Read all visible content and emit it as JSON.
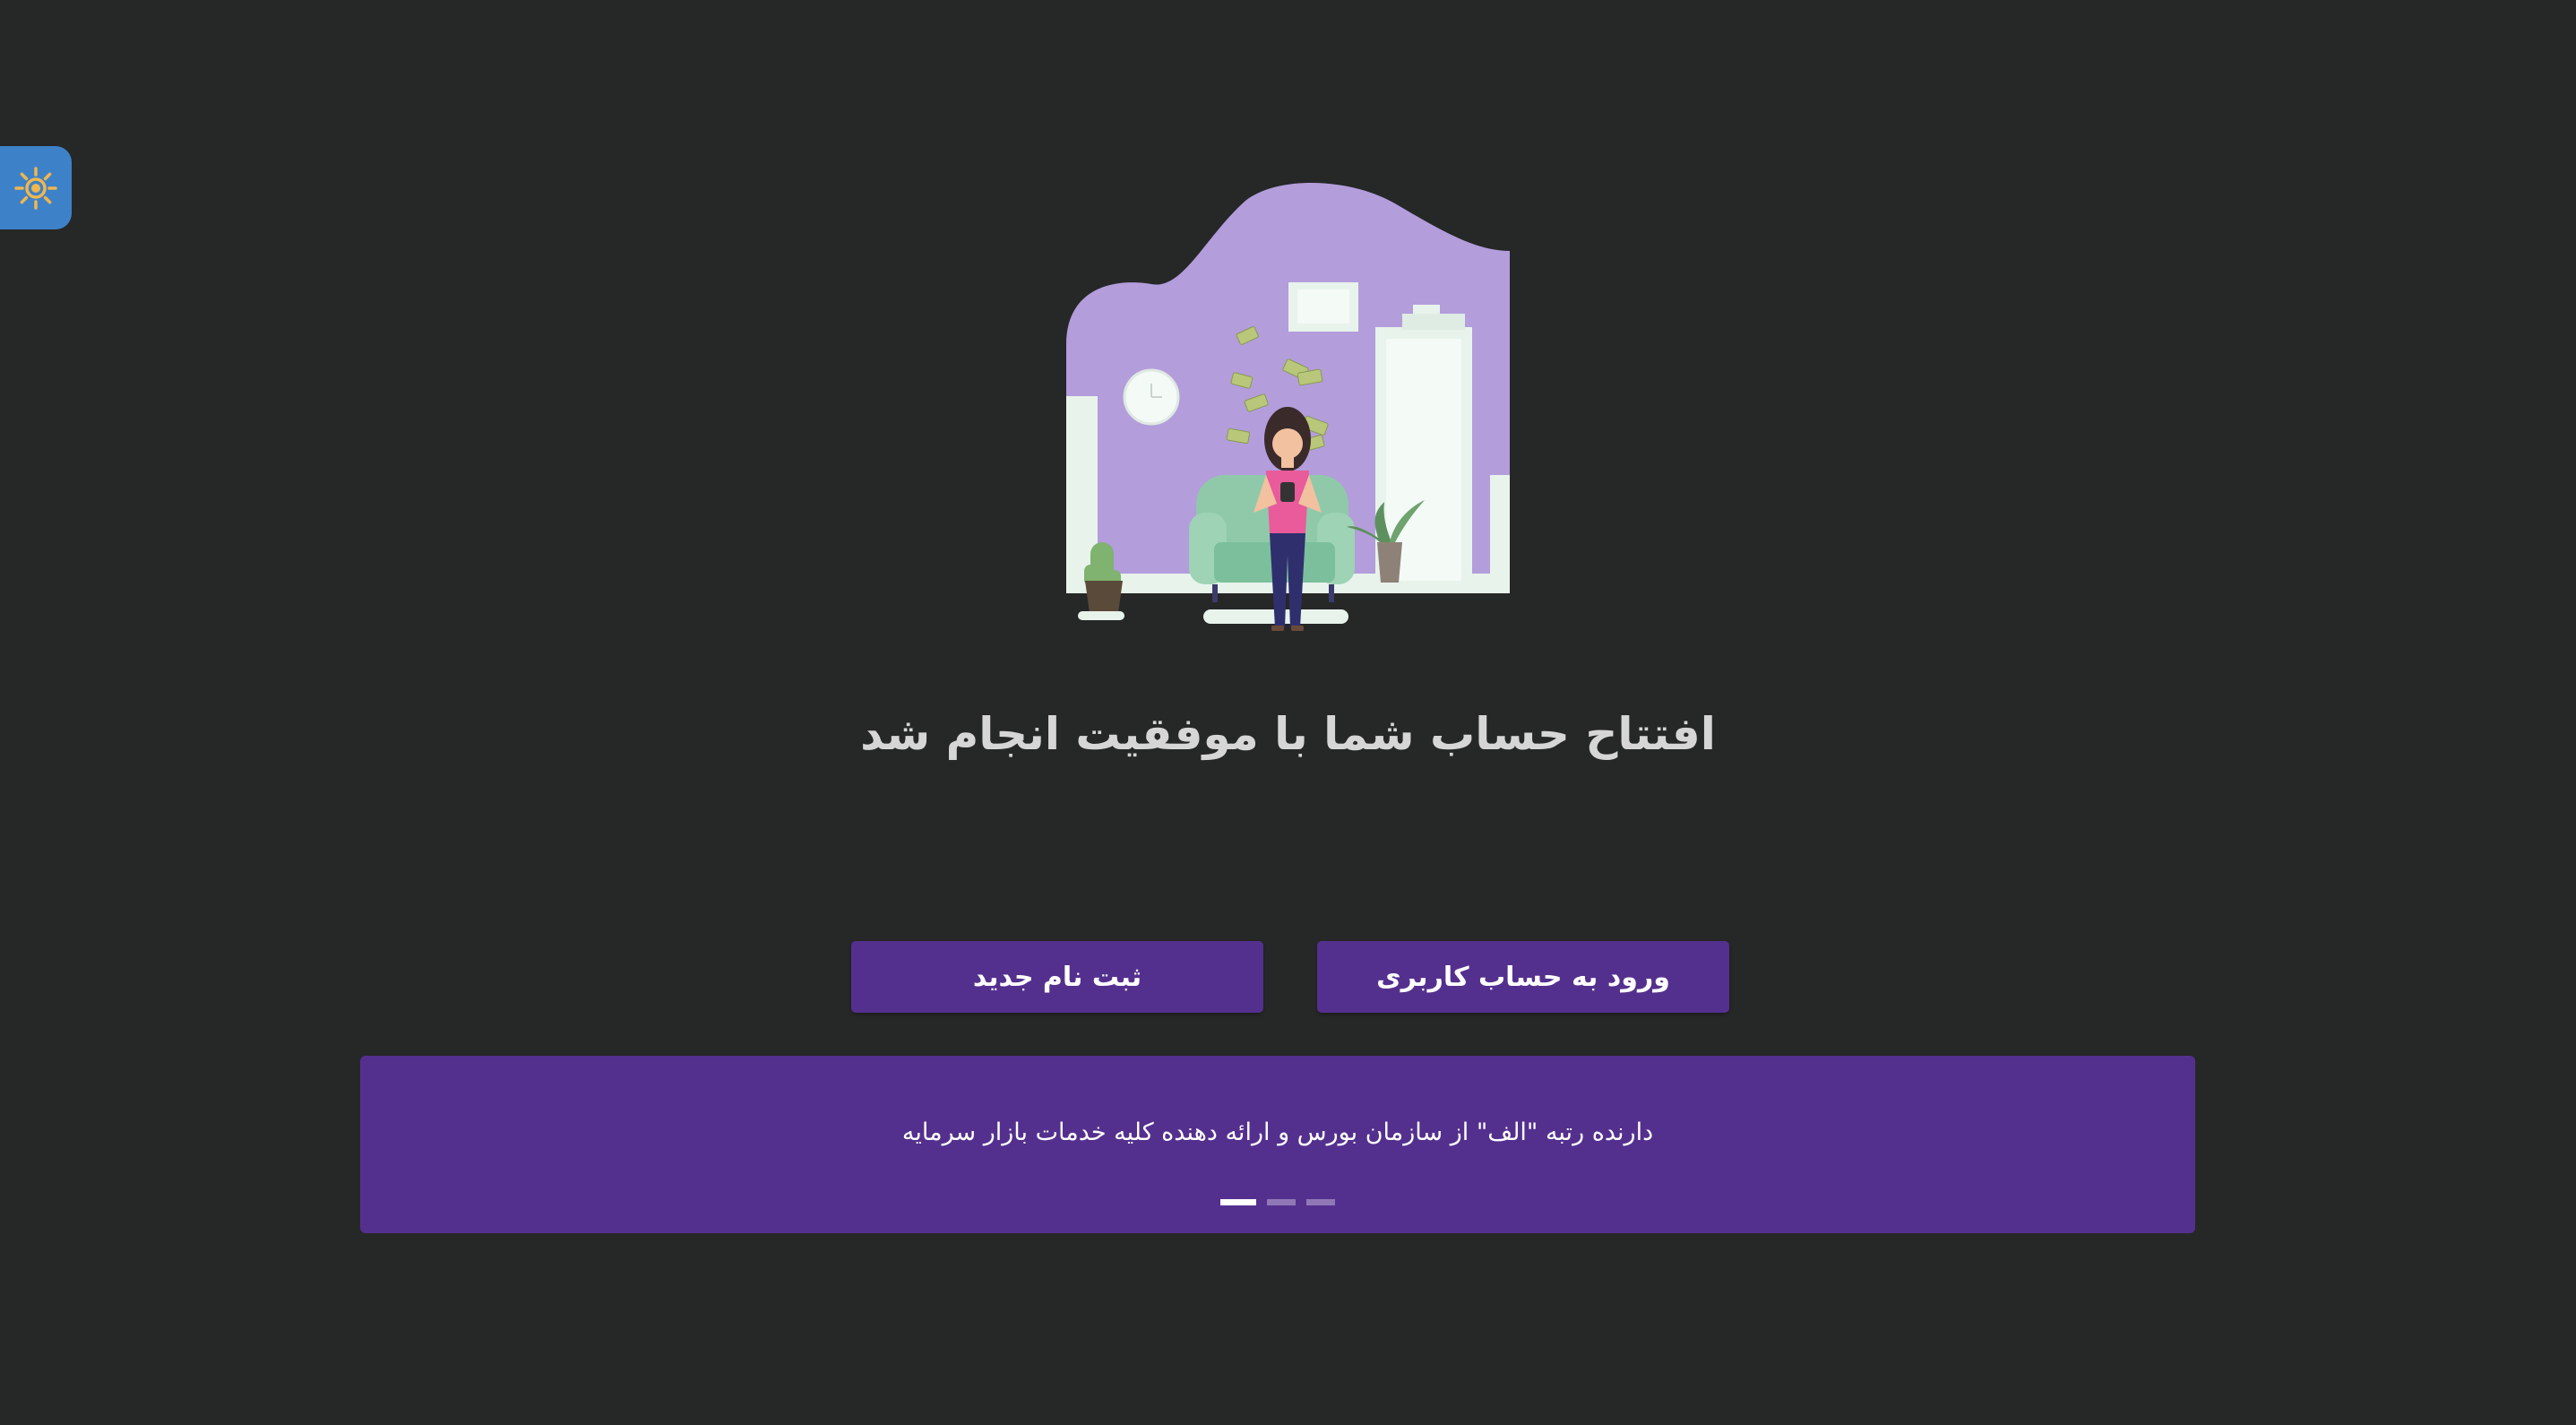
{
  "theme_toggle": {
    "icon": "sun-icon",
    "color": "#3d82c8",
    "icon_color": "#f0b64f"
  },
  "illustration": {
    "subject": "woman-on-armchair-money-illustration"
  },
  "page": {
    "title": "افتتاح حساب شما با موفقیت انجام شد"
  },
  "actions": {
    "login_label": "ورود به حساب کاربری",
    "signup_label": "ثبت نام جدید",
    "button_color": "#54308e"
  },
  "banner": {
    "text": "دارنده رتبه \"الف\" از سازمان بورس و ارائه دهنده کلیه خدمات بازار سرمایه",
    "slide_count": 3,
    "active_slide": 1,
    "color": "#54308e"
  }
}
